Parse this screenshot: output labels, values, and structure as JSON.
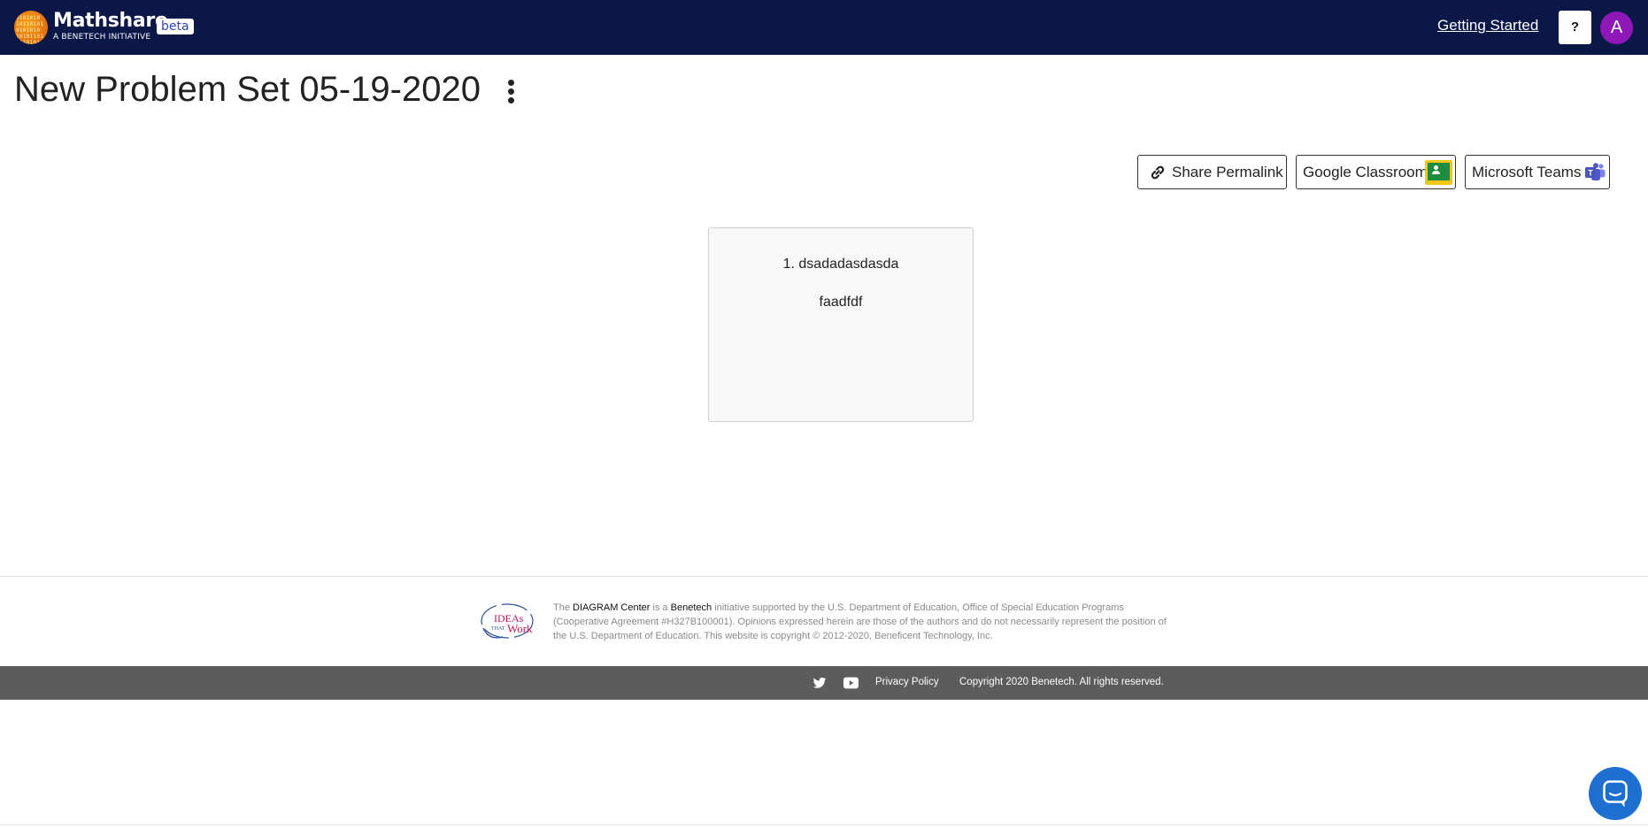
{
  "header": {
    "brand_name": "Mathshare",
    "brand_tagline": "A BENETECH INITIATIVE",
    "badge": "beta",
    "getting_started": "Getting Started",
    "help_label": "?",
    "avatar_initial": "A",
    "background_color": "#0b1747"
  },
  "page": {
    "title": "New Problem Set 05-19-2020"
  },
  "share": {
    "permalink_label": "Share Permalink",
    "classroom_label": "Google Classroom",
    "teams_label": "Microsoft Teams"
  },
  "problems": [
    {
      "title": "1. dsadadasdasda",
      "body": "faadfdf"
    }
  ],
  "footer": {
    "text_the": "The ",
    "diagram_center": "DIAGRAM Center",
    "text_is_a": " is a ",
    "benetech": "Benetech",
    "text_rest": " initiative supported by the U.S. Department of Education, Office of Special Education Programs (Cooperative Agreement #H327B100001). Opinions expressed herein are those of the authors and do not necessarily represent the position of the U.S. Department of Education. This website is copyright © 2012-2020, Beneficent Technology, Inc.",
    "privacy_policy": "Privacy Policy",
    "copyright": "Copyright 2020 Benetech. All rights reserved."
  },
  "icons": {
    "logo": "mathshare-logo-icon",
    "help": "question-icon",
    "kebab": "kebab-menu-icon",
    "permalink": "link-icon",
    "classroom": "google-classroom-icon",
    "teams": "microsoft-teams-icon",
    "twitter": "twitter-icon",
    "youtube": "youtube-icon",
    "chat": "chat-icon"
  }
}
